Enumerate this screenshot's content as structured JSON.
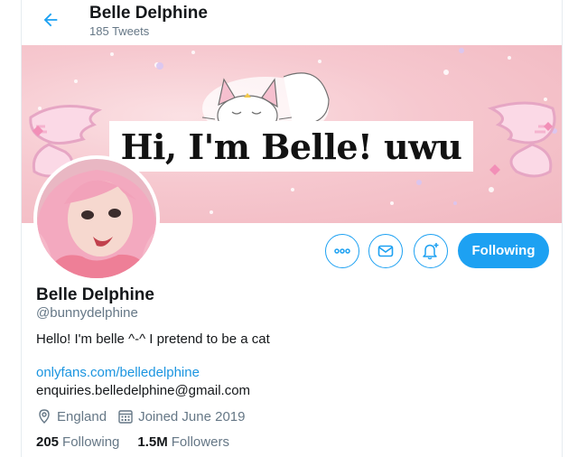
{
  "header": {
    "title": "Belle Delphine",
    "tweet_count": "185 Tweets"
  },
  "banner": {
    "text": "Hi, I'm Belle! uwu"
  },
  "actions": {
    "following_label": "Following"
  },
  "profile": {
    "name": "Belle Delphine",
    "handle": "@bunnydelphine",
    "bio": "Hello! I'm belle ^-^ I pretend to be a cat",
    "link": "onlyfans.com/belledelphine",
    "email": "enquiries.belledelphine@gmail.com",
    "location": "England",
    "joined": "Joined June 2019",
    "following_count": "205",
    "following_label": "Following",
    "followers_count": "1.5M",
    "followers_label": "Followers"
  },
  "colors": {
    "accent": "#1da1f2",
    "link": "#1b95e0",
    "secondary_text": "#657786",
    "banner_pink": "#f6c8cf"
  },
  "icons": [
    "back-arrow-icon",
    "more-icon",
    "mail-icon",
    "bell-plus-icon",
    "location-pin-icon",
    "calendar-icon"
  ]
}
